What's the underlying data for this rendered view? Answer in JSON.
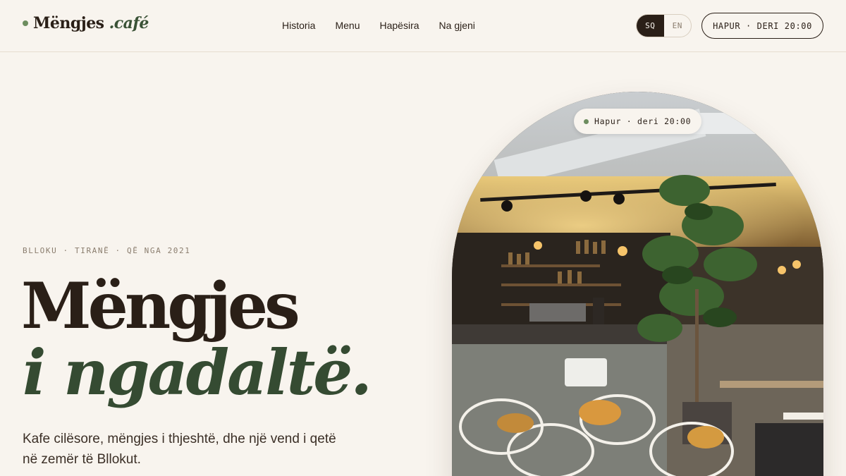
{
  "brand": {
    "name": "Mëngjes",
    "suffix": ".café"
  },
  "nav": [
    {
      "label": "Historia"
    },
    {
      "label": "Menu"
    },
    {
      "label": "Hapësira"
    },
    {
      "label": "Na gjeni"
    }
  ],
  "language": {
    "active": "SQ",
    "inactive": "EN"
  },
  "header_status": "HAPUR · DERI 20:00",
  "hero": {
    "eyebrow": "BLLOKU · TIRANË · QË NGA 2021",
    "title_line1": "Mëngjes",
    "title_line2": "i ngadaltë.",
    "lede": "Kafe cilësore, mëngjes i thjeshtë, dhe një vend i qetë në zemër të Bllokut."
  },
  "photo": {
    "status_pill": "Hapur · deri 20:00"
  },
  "colors": {
    "background": "#f8f4ee",
    "ink": "#2a1f17",
    "accent_green": "#354b32",
    "status_dot": "#6d8d5f"
  }
}
